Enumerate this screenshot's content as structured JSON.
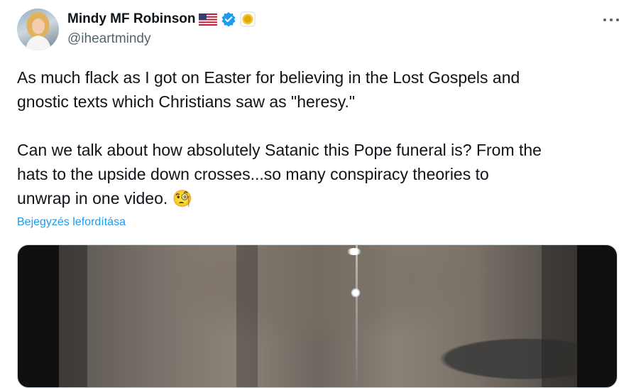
{
  "author": {
    "display_name": "Mindy MF Robinson",
    "handle": "@iheartmindy",
    "flag_icon": "us-flag-icon",
    "verified_icon": "verified-badge-icon",
    "affiliate_icon": "gold-circle-icon"
  },
  "tweet": {
    "text": "As much flack as I got on Easter for believing in the Lost Gospels and\ngnostic texts which Christians saw as \"heresy.\"\n\nCan we talk about how absolutely Satanic this Pope funeral is? From the\nhats to the upside down crosses...so many conspiracy theories to\nunwrap in one video. 🧐",
    "translate_label": "Bejegyzés lefordítása"
  },
  "colors": {
    "text": "#0f1419",
    "secondary": "#536471",
    "link": "#1d9bf0",
    "verified": "#1d9bf0"
  }
}
